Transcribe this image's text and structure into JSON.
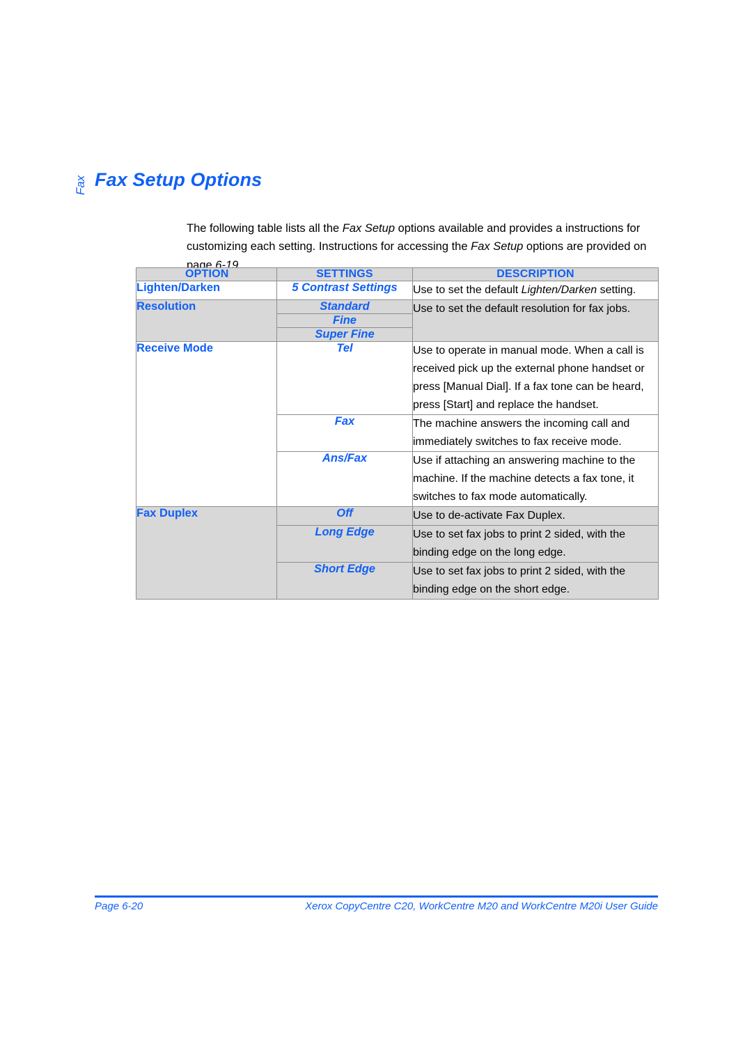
{
  "heading": {
    "chapter_tab": "Fax",
    "title": "Fax Setup Options"
  },
  "intro": {
    "part1": "The following table lists all the ",
    "em1": "Fax Setup",
    "part2": " options available and provides a instructions for customizing each setting. Instructions for accessing the ",
    "em2": "Fax Setup",
    "part3": " options are provided on page ",
    "em3": "6-19",
    "part4": "."
  },
  "table": {
    "headers": {
      "option": "OPTION",
      "settings": "SETTINGS",
      "description": "DESCRIPTION"
    },
    "rows": [
      {
        "option": "Lighten/Darken",
        "setting": "5 Contrast Settings",
        "desc_pre": "Use to set the default ",
        "desc_em": "Lighten/Darken",
        "desc_post": " setting.",
        "bg": "white"
      },
      {
        "option": "Resolution",
        "setting": "Standard",
        "desc": "Use to set the default resolution for fax jobs.",
        "bg": "grey"
      },
      {
        "setting": "Fine",
        "bg": "grey"
      },
      {
        "setting": "Super Fine",
        "bg": "grey"
      },
      {
        "option": "Receive Mode",
        "setting": "Tel",
        "desc": "Use to operate in manual mode. When a call is received pick up the external phone handset or press [Manual Dial]. If a fax tone can be heard, press [Start] and replace the handset.",
        "bg": "white"
      },
      {
        "setting": "Fax",
        "desc": "The machine answers the incoming call and immediately switches to fax receive mode.",
        "bg": "white"
      },
      {
        "setting": "Ans/Fax",
        "desc": "Use if attaching an answering machine to the machine. If the machine detects a fax tone, it switches to fax mode automatically.",
        "bg": "white"
      },
      {
        "option": "Fax Duplex",
        "setting": "Off",
        "desc": "Use to de-activate Fax Duplex.",
        "bg": "grey"
      },
      {
        "setting": "Long Edge",
        "desc": "Use to set fax jobs to print 2 sided, with the binding edge on the long edge.",
        "bg": "grey"
      },
      {
        "setting": "Short Edge",
        "desc": "Use to set fax jobs to print 2 sided, with the binding edge on the short edge.",
        "bg": "grey"
      }
    ]
  },
  "footer": {
    "page_label": "Page 6-20",
    "guide_title": "Xerox CopyCentre C20, WorkCentre M20 and WorkCentre M20i User Guide"
  },
  "colors": {
    "accent_blue": "#1060f5",
    "header_grey": "#d8d8d8",
    "border_grey": "#8d8d8d"
  }
}
